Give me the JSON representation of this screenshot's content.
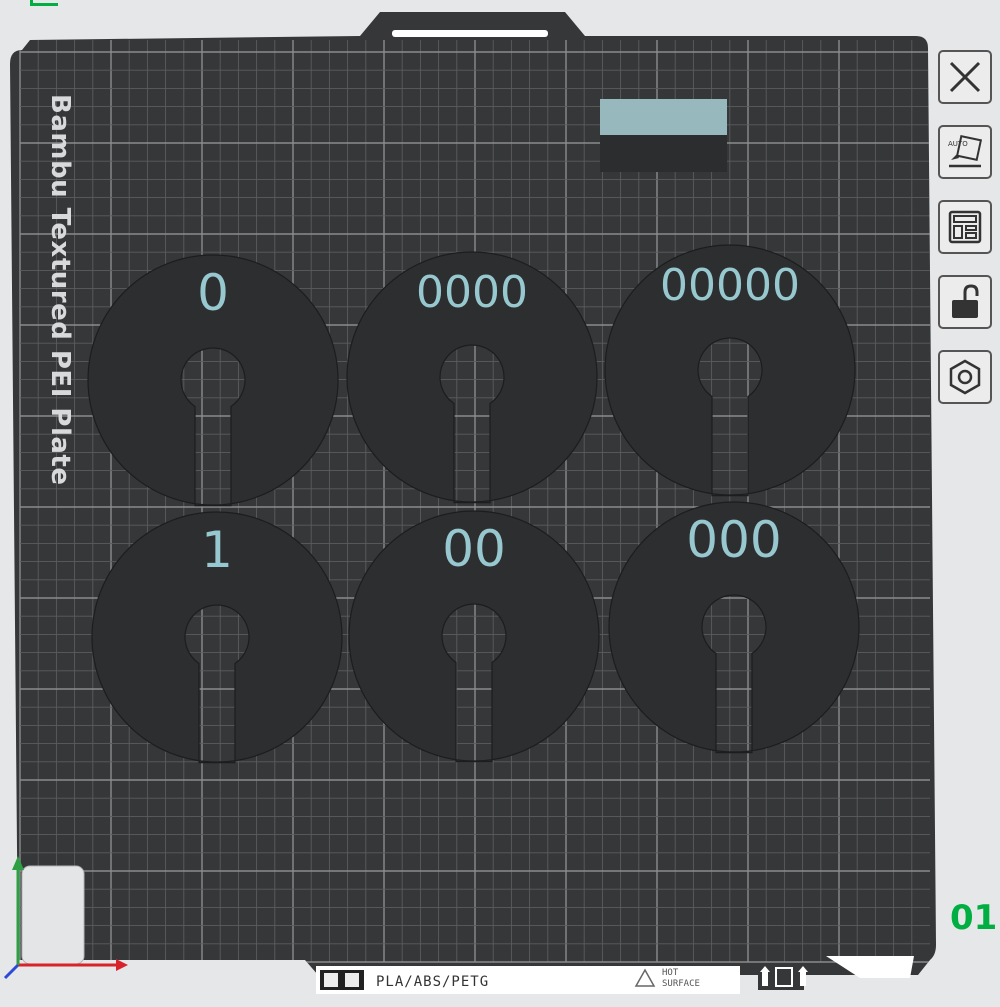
{
  "plate": {
    "name": "Bambu Textured PEI Plate",
    "filament_types": "PLA/ABS/PETG",
    "hot_surface_line1": "HOT",
    "hot_surface_line2": "SURFACE",
    "number": "01"
  },
  "parts": [
    {
      "label": "0"
    },
    {
      "label": "0000"
    },
    {
      "label": "00000"
    },
    {
      "label": "1"
    },
    {
      "label": "00"
    },
    {
      "label": "000"
    }
  ],
  "colors": {
    "bed": "#363738",
    "grid_minor": "#5a5c5e",
    "grid_major": "#8a8c8e",
    "part": "#2d2e2f",
    "label": "#97c7cf",
    "accent": "#00ae42"
  },
  "toolbar": [
    {
      "icon": "close-icon"
    },
    {
      "icon": "auto-orient-icon"
    },
    {
      "icon": "arrange-icon"
    },
    {
      "icon": "lock-icon"
    },
    {
      "icon": "settings-hex-icon"
    }
  ]
}
